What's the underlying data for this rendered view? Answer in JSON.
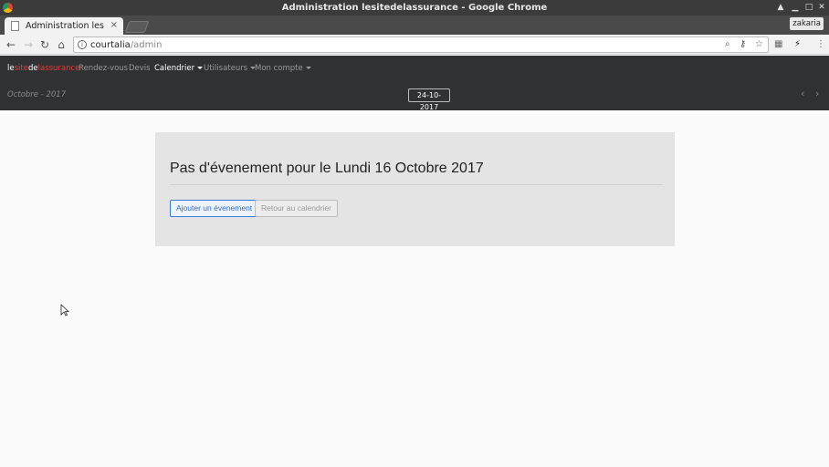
{
  "window": {
    "title": "Administration lesitedelassurance - Google Chrome",
    "profile": "zakaria"
  },
  "tab": {
    "title": "Administration lesit",
    "close": "×"
  },
  "address": {
    "host": "courtalia",
    "path": "/admin"
  },
  "brand": {
    "part1": "le",
    "part2": "site",
    "part3": "de",
    "part4": "lassurance"
  },
  "nav": {
    "items": [
      {
        "label": "Rendez-vous"
      },
      {
        "label": "Devis"
      },
      {
        "label": "Calendrier"
      },
      {
        "label": "Utilisateurs"
      },
      {
        "label": "Mon compte"
      }
    ]
  },
  "calendar": {
    "month_label": "Octobre - 2017",
    "date_value": "24-10-2017"
  },
  "main": {
    "heading": "Pas d'évenement pour le Lundi 16 Octobre 2017",
    "add_button": "Ajouter un évenement",
    "back_button": "Retour au calendrier"
  },
  "colors": {
    "navbar_bg": "#2f3133",
    "brand_accent": "#e0403a",
    "primary": "#3a7bd5",
    "panel_bg": "#e4e4e4"
  }
}
